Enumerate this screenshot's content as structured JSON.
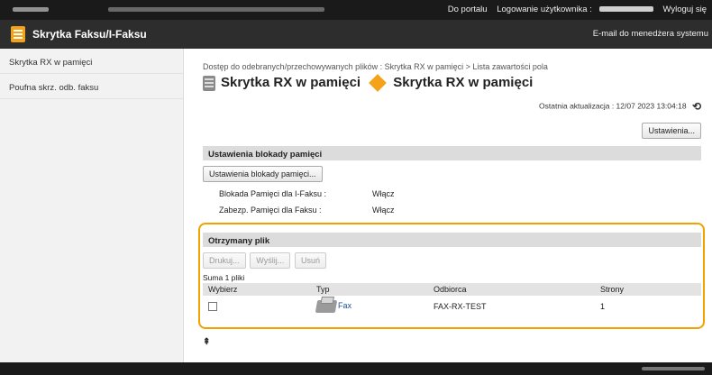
{
  "header": {
    "portal_link": "Do portalu",
    "login_user_label": "Logowanie użytkownika :",
    "logout_link": "Wyloguj się"
  },
  "titlebar": {
    "title": "Skrytka Faksu/I-Faksu",
    "admin_mail": "E-mail do menedżera systemu"
  },
  "sidebar": {
    "items": [
      {
        "label": "Skrytka RX w pamięci"
      },
      {
        "label": "Poufna skrz. odb. faksu"
      }
    ]
  },
  "main": {
    "breadcrumb": "Dostęp do odebranych/przechowywanych plików : Skrytka RX w pamięci > Lista zawartości pola",
    "title_part1": "Skrytka RX w pamięci",
    "title_part2": "Skrytka RX w pamięci",
    "last_update": "Ostatnia aktualizacja : 12/07 2023 13:04:18",
    "settings_button": "Ustawienia...",
    "lock_section": {
      "header": "Ustawienia blokady pamięci",
      "button": "Ustawienia blokady pamięci...",
      "rows": [
        {
          "label": "Blokada Pamięci dla I-Faksu :",
          "value": "Włącz"
        },
        {
          "label": "Zabezp. Pamięci dla Faksu :",
          "value": "Włącz"
        }
      ]
    },
    "files_section": {
      "header": "Otrzymany plik",
      "buttons": {
        "print": "Drukuj...",
        "send": "Wyślij...",
        "delete": "Usuń"
      },
      "count": "Suma 1 pliki",
      "columns": [
        "Wybierz",
        "Typ",
        "Odbiorca",
        "Strony"
      ],
      "rows": [
        {
          "type": "Fax",
          "recipient": "FAX-RX-TEST",
          "pages": "1"
        }
      ]
    }
  },
  "icons": {
    "refresh": "refresh-icon",
    "scroll_top": "scroll-to-top-icon",
    "fax": "fax-icon"
  },
  "colors": {
    "highlight": "#f0a300",
    "accent": "#f3a21a",
    "link": "#1a4fa0"
  }
}
